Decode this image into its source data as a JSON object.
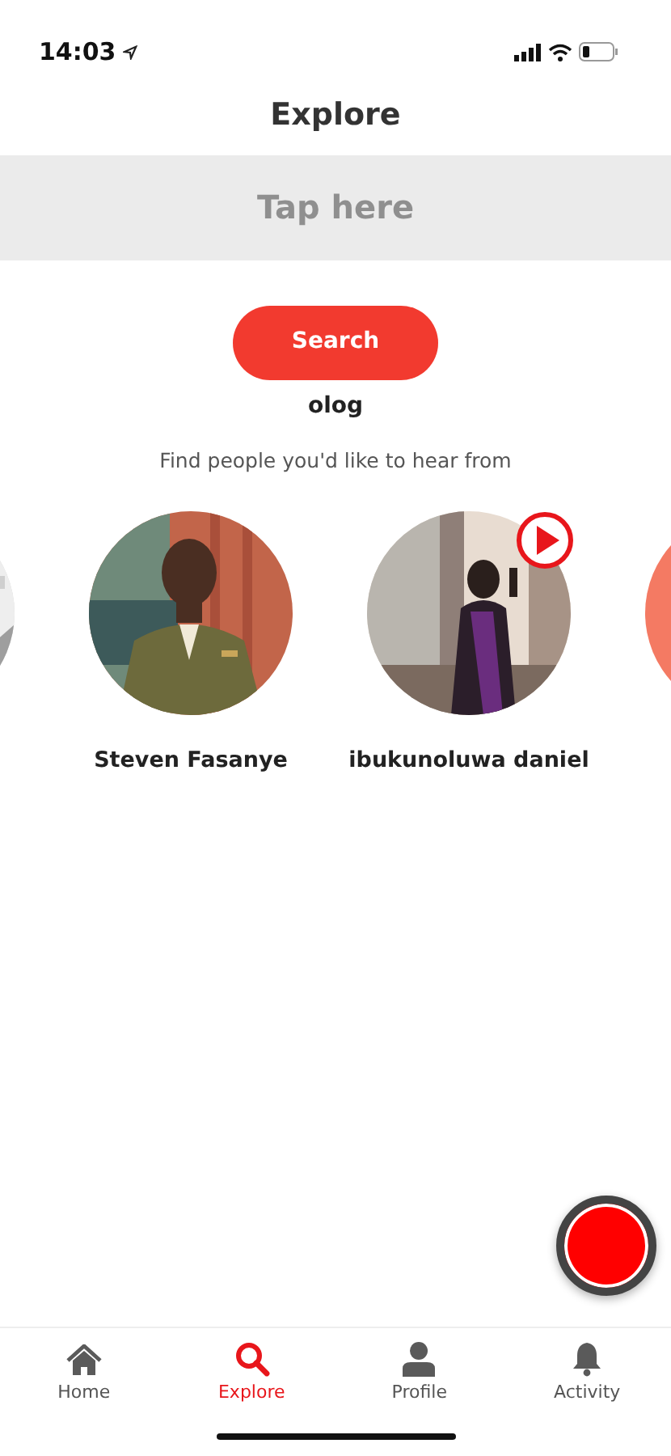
{
  "status_bar": {
    "time": "14:03"
  },
  "header": {
    "title": "Explore"
  },
  "search_field": {
    "placeholder": "Tap here"
  },
  "search_button": {
    "label": "Search"
  },
  "query": "olog",
  "subtitle": "Find people you'd like to hear from",
  "people": [
    {
      "kind": "picture",
      "has_video": false
    },
    {
      "kind": "picture",
      "name": "Steven Fasanye",
      "has_video": false
    },
    {
      "kind": "picture",
      "name": "ibukunoluwa daniel",
      "has_video": true
    },
    {
      "kind": "blank"
    }
  ],
  "tabs": [
    {
      "label": "Home",
      "selected": false
    },
    {
      "label": "Explore",
      "selected": true
    },
    {
      "label": "Profile",
      "selected": false
    },
    {
      "label": "Activity",
      "selected": false
    }
  ]
}
